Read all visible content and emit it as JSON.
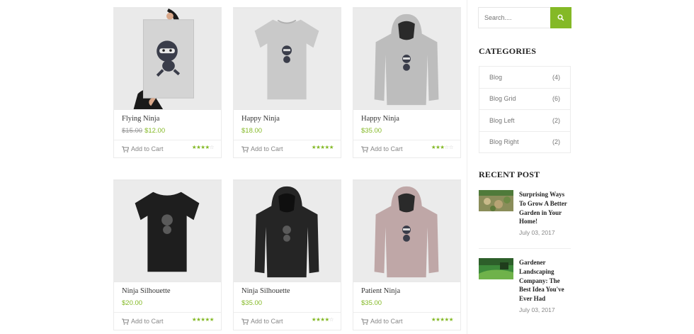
{
  "products": [
    {
      "name": "Flying Ninja",
      "old_price": "$15.00",
      "price": "$12.00",
      "cart": "Add to Cart",
      "rating": 4,
      "image": "poster"
    },
    {
      "name": "Happy Ninja",
      "old_price": "",
      "price": "$18.00",
      "cart": "Add to Cart",
      "rating": 5,
      "image": "tshirt-gray"
    },
    {
      "name": "Happy Ninja",
      "old_price": "",
      "price": "$35.00",
      "cart": "Add to Cart",
      "rating": 3,
      "image": "hoodie-gray"
    },
    {
      "name": "Ninja Silhouette",
      "old_price": "",
      "price": "$20.00",
      "cart": "Add to Cart",
      "rating": 5,
      "image": "tshirt-black"
    },
    {
      "name": "Ninja Silhouette",
      "old_price": "",
      "price": "$35.00",
      "cart": "Add to Cart",
      "rating": 4,
      "image": "hoodie-black"
    },
    {
      "name": "Patient Ninja",
      "old_price": "",
      "price": "$35.00",
      "cart": "Add to Cart",
      "rating": 5,
      "image": "hoodie-pink"
    }
  ],
  "search": {
    "placeholder": "Search....",
    "icon": "search-icon"
  },
  "categories": {
    "title": "CATEGORIES",
    "items": [
      {
        "label": "Blog",
        "count": "(4)"
      },
      {
        "label": "Blog Grid",
        "count": "(6)"
      },
      {
        "label": "Blog Left",
        "count": "(2)"
      },
      {
        "label": "Blog Right",
        "count": "(2)"
      }
    ]
  },
  "recent": {
    "title": "RECENT POST",
    "posts": [
      {
        "title": "Surprising Ways To Grow A Better Garden in Your Home!",
        "date": "July 03, 2017"
      },
      {
        "title": "Gardener Landscaping Company: The Best Idea You've Ever Had",
        "date": "July 03, 2017"
      }
    ]
  },
  "colors": {
    "accent": "#84b926"
  }
}
